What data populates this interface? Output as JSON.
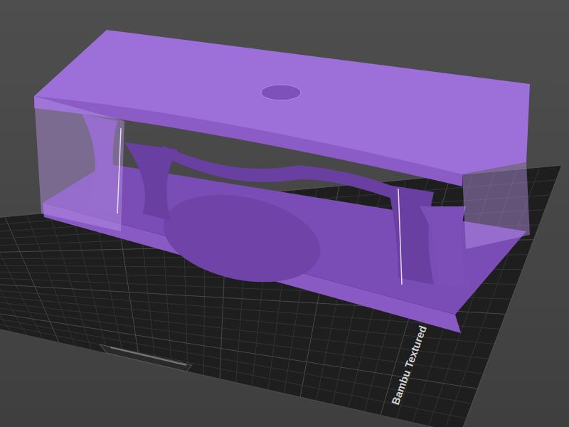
{
  "plate": {
    "label": "Bambu Textured"
  }
}
